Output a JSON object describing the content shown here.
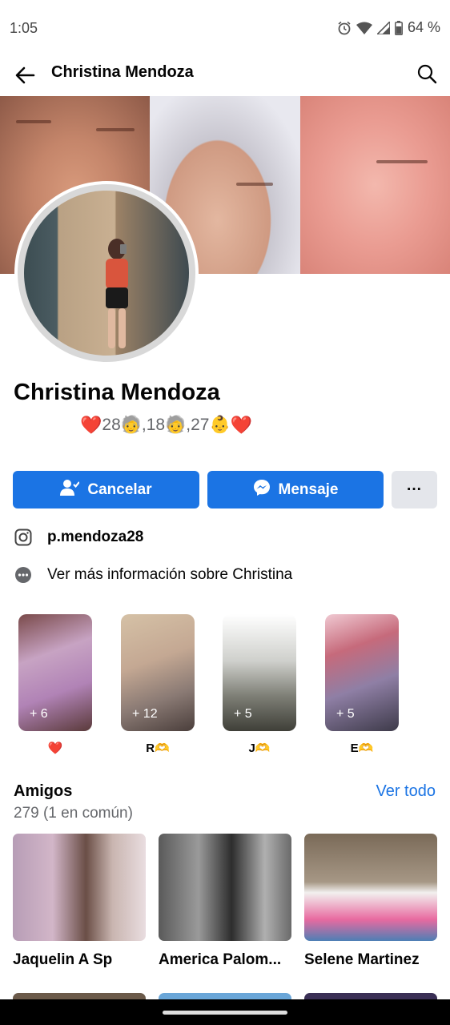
{
  "status_bar": {
    "time": "1:05",
    "battery": "64 %"
  },
  "header": {
    "title": "Christina Mendoza"
  },
  "profile": {
    "name": "Christina Mendoza",
    "bio_heart": "❤️",
    "bio_text": "28🧓,18🧓,27👶",
    "bio_heart_end": "❤️"
  },
  "actions": {
    "cancel_label": "Cancelar",
    "message_label": "Mensaje",
    "more_label": "···"
  },
  "info": {
    "instagram": "p.mendoza28",
    "more_info": "Ver más información sobre Christina"
  },
  "highlights": [
    {
      "count": "+ 6",
      "label": "❤️"
    },
    {
      "count": "+ 12",
      "label": "R🫶"
    },
    {
      "count": "+ 5",
      "label": "J🫶"
    },
    {
      "count": "+ 5",
      "label": "E🫶"
    }
  ],
  "friends": {
    "title": "Amigos",
    "see_all": "Ver todo",
    "count": "279 (1 en común)",
    "items": [
      {
        "name": "Jaquelin A Sp"
      },
      {
        "name": "America Palom..."
      },
      {
        "name": "Selene Martinez"
      }
    ]
  }
}
